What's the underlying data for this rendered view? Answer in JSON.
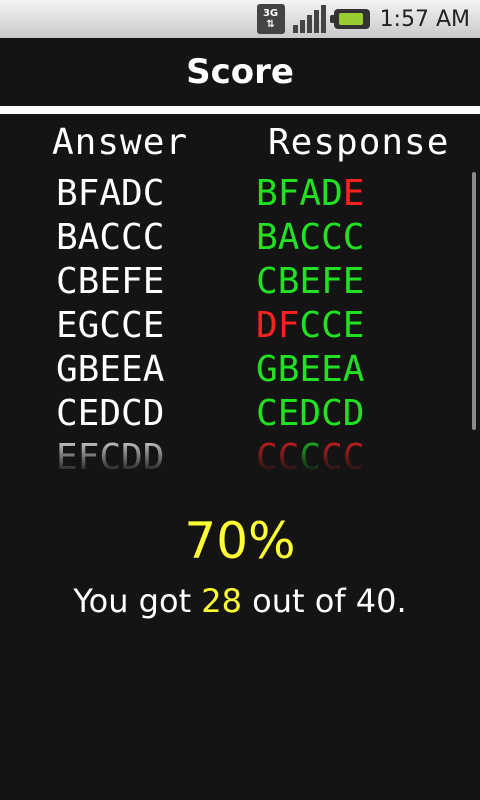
{
  "statusbar": {
    "network_label_top": "3G",
    "network_label_bottom": "⇅",
    "time": "1:57 AM",
    "icons": [
      "network-3g-icon",
      "signal-bars-icon",
      "battery-icon"
    ]
  },
  "header": {
    "title": "Score"
  },
  "columns": {
    "answer": "Answer",
    "response": "Response"
  },
  "rows": [
    {
      "answer": "BFADC",
      "response": [
        [
          "B",
          "ok"
        ],
        [
          "F",
          "ok"
        ],
        [
          "A",
          "ok"
        ],
        [
          "D",
          "ok"
        ],
        [
          "E",
          "bad"
        ]
      ]
    },
    {
      "answer": "BACCC",
      "response": [
        [
          "B",
          "ok"
        ],
        [
          "A",
          "ok"
        ],
        [
          "C",
          "ok"
        ],
        [
          "C",
          "ok"
        ],
        [
          "C",
          "ok"
        ]
      ]
    },
    {
      "answer": "CBEFE",
      "response": [
        [
          "C",
          "ok"
        ],
        [
          "B",
          "ok"
        ],
        [
          "E",
          "ok"
        ],
        [
          "F",
          "ok"
        ],
        [
          "E",
          "ok"
        ]
      ]
    },
    {
      "answer": "EGCCE",
      "response": [
        [
          "D",
          "bad"
        ],
        [
          "F",
          "bad"
        ],
        [
          "C",
          "ok"
        ],
        [
          "C",
          "ok"
        ],
        [
          "E",
          "ok"
        ]
      ]
    },
    {
      "answer": "GBEEA",
      "response": [
        [
          "G",
          "ok"
        ],
        [
          "B",
          "ok"
        ],
        [
          "E",
          "ok"
        ],
        [
          "E",
          "ok"
        ],
        [
          "A",
          "ok"
        ]
      ]
    },
    {
      "answer": "CEDCD",
      "response": [
        [
          "C",
          "ok"
        ],
        [
          "E",
          "ok"
        ],
        [
          "D",
          "ok"
        ],
        [
          "C",
          "ok"
        ],
        [
          "D",
          "ok"
        ]
      ]
    },
    {
      "answer": "EFCDD",
      "response": [
        [
          "C",
          "bad"
        ],
        [
          "C",
          "bad"
        ],
        [
          "C",
          "ok"
        ],
        [
          "C",
          "bad"
        ],
        [
          "C",
          "bad"
        ]
      ]
    }
  ],
  "result": {
    "percent": "70%",
    "summary_prefix": "You got ",
    "correct": "28",
    "summary_middle": " out of ",
    "total": "40",
    "summary_suffix": "."
  },
  "colors": {
    "correct": "#22e022",
    "incorrect": "#ff2020",
    "highlight": "#ffff33"
  }
}
